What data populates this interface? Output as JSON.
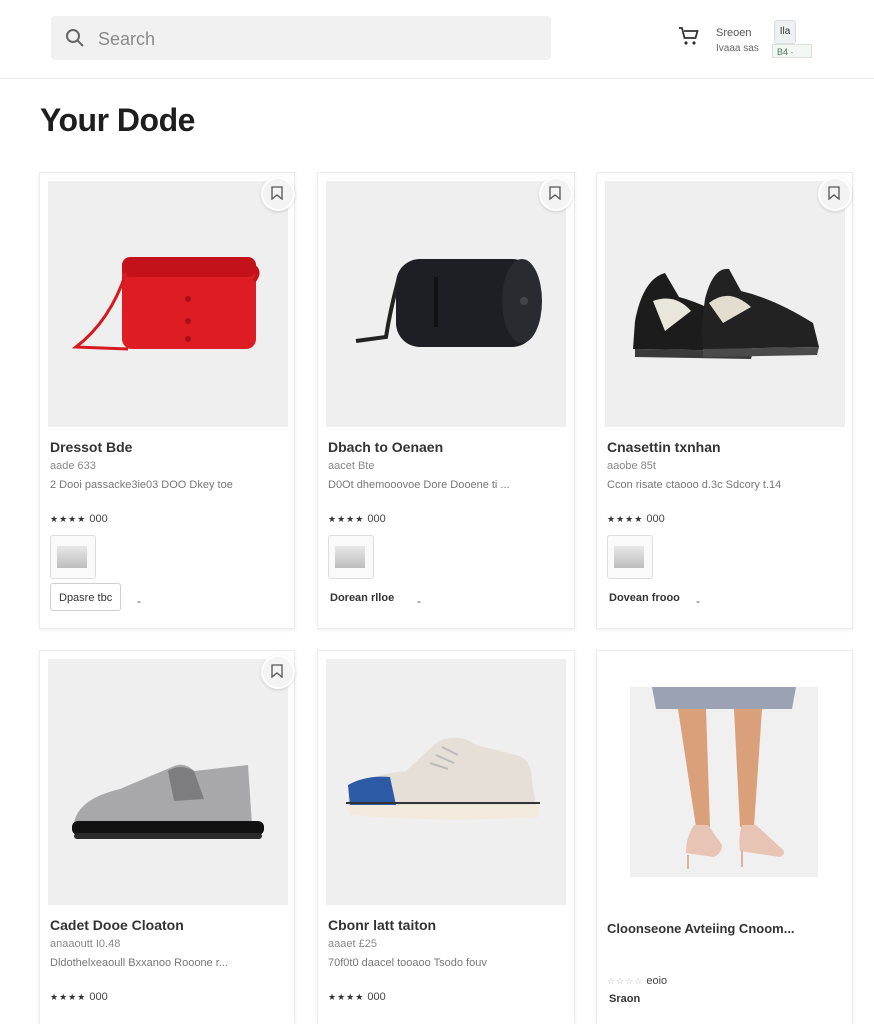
{
  "header": {
    "search_placeholder": "Search",
    "account_line1": "Sreoen",
    "account_line2": "Ivaaa sas",
    "avatar_text": "Ila",
    "badge_text": "B4 ·"
  },
  "page": {
    "title": "Your Dode"
  },
  "colors": {
    "accent": "#222222",
    "badge": "#4a7a55"
  },
  "products": [
    {
      "title": "Dressot Bde",
      "subtitle": "aade 633",
      "description": "2 Dooi passacke3ie03 DOO Dkey toe",
      "stars": "★★★★",
      "rating": "000",
      "action": "Dpasre tbc",
      "item": "red-bag"
    },
    {
      "title": "Dbach to Oenaen",
      "subtitle": "aacet Bte",
      "description": "D0Ot dhemooovoe Dore Dooene ti ...",
      "stars": "★★★★",
      "rating": "000",
      "action": "Dorean rlloe",
      "item": "black-bag"
    },
    {
      "title": "Cnasettin txnhan",
      "subtitle": "aaobe 85t",
      "description": "Ccon risate ctaooo d.3c Sdcory t.14",
      "stars": "★★★★",
      "rating": "000",
      "action": "Dovean frooo",
      "item": "black-sneakers"
    },
    {
      "title": "Cadet Dooe Cloaton",
      "subtitle": "anaaoutt I0.48",
      "description": "Dldothelxeaoull Bxxanoo Rooone r...",
      "stars": "★★★★",
      "rating": "000",
      "item": "silver-loafer"
    },
    {
      "title": "Cbonr latt taiton",
      "subtitle": "aaaet £25",
      "description": "70f0t0 daacel tooaoo Tsodo fouv",
      "stars": "★★★★",
      "rating": "000",
      "item": "white-sneaker"
    },
    {
      "title": "Cloonseone Avteiing Cnoom...",
      "stars": "☆☆☆☆",
      "rating": "eoio",
      "action": "Sraon",
      "item": "heels"
    }
  ]
}
